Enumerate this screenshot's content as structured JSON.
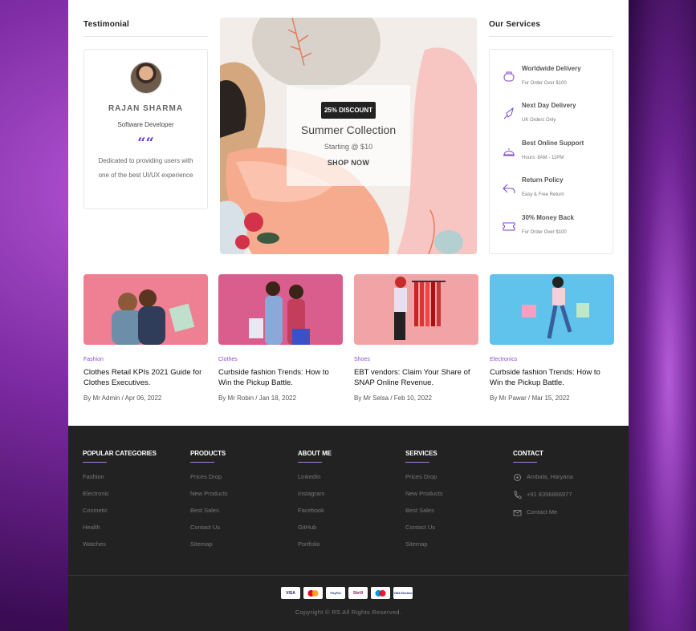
{
  "testimonial": {
    "heading": "Testimonial",
    "name": "RAJAN SHARMA",
    "role": "Software Developer",
    "quote_icon": "““",
    "text": "Dedicated to providing users with one of the best UI/UX experience"
  },
  "banner": {
    "badge": "25% DISCOUNT",
    "title": "Summer Collection",
    "subtitle": "Starting @ $10",
    "cta": "SHOP NOW"
  },
  "services": {
    "heading": "Our Services",
    "items": [
      {
        "icon": "truck-icon",
        "title": "Worldwide Delivery",
        "sub": "For Order Over $100"
      },
      {
        "icon": "rocket-icon",
        "title": "Next Day Delivery",
        "sub": "UK Orders Only"
      },
      {
        "icon": "support-bell-icon",
        "title": "Best Online Support",
        "sub": "Hours: 8AM - 11PM"
      },
      {
        "icon": "return-arrow-icon",
        "title": "Return Policy",
        "sub": "Easy & Free Return"
      },
      {
        "icon": "ticket-icon",
        "title": "30% Money Back",
        "sub": "For Order Over $100"
      }
    ]
  },
  "posts": [
    {
      "category": "Fashion",
      "title": "Clothes Retail KPIs 2021 Guide for Clothes Executives.",
      "meta": "By Mr Admin / Apr 06, 2022",
      "bg": "#ef7f92"
    },
    {
      "category": "Clothes",
      "title": "Curbside fashion Trends: How to Win the Pickup Battle.",
      "meta": "By Mr Robin / Jan 18, 2022",
      "bg": "#d95d8d"
    },
    {
      "category": "Shoes",
      "title": "EBT vendors: Claim Your Share of SNAP Online Revenue.",
      "meta": "By Mr Selsa / Feb 10, 2022",
      "bg": "#f1a3a6"
    },
    {
      "category": "Electronics",
      "title": "Curbside fashion Trends: How to Win the Pickup Battle.",
      "meta": "By Mr Pawar / Mar 15, 2022",
      "bg": "#5fc3eb"
    }
  ],
  "footer": {
    "columns": [
      {
        "heading": "POPULAR CATEGORIES",
        "links": [
          "Fashion",
          "Electronic",
          "Cosmetic",
          "Health",
          "Watches"
        ]
      },
      {
        "heading": "PRODUCTS",
        "links": [
          "Prices Drop",
          "New Products",
          "Best Sales",
          "Contact Us",
          "Sitemap"
        ]
      },
      {
        "heading": "ABOUT ME",
        "links": [
          "LinkedIn",
          "Instagram",
          "Facebook",
          "GitHub",
          "Portfolio"
        ]
      },
      {
        "heading": "SERVICES",
        "links": [
          "Prices Drop",
          "New Products",
          "Best Sales",
          "Contact Us",
          "Sitemap"
        ]
      }
    ],
    "contact": {
      "heading": "CONTACT",
      "location": "Ambala, Haryana",
      "phone": "+91 8396866977",
      "email": "Contact Me"
    },
    "payments": [
      "VISA",
      "Mastercard",
      "PayPal",
      "Skrill",
      "Maestro",
      "VISA Electron"
    ],
    "copyright": "Copyright © RS All Rights Reserved."
  }
}
